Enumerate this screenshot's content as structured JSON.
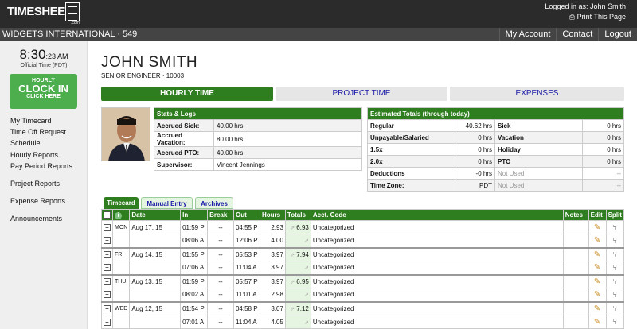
{
  "header": {
    "logo": "TIMESHEETS",
    "logo_suffix": ".com",
    "logged_in": "Logged in as: John Smith",
    "print": "Print This Page"
  },
  "subheader": {
    "company": "WIDGETS INTERNATIONAL · 549",
    "nav": [
      "My Account",
      "Contact",
      "Logout"
    ]
  },
  "clock": {
    "hm": "8:30",
    "sec": ":23 AM",
    "tz": "Official Time (PDT)",
    "btn_l1": "HOURLY",
    "btn_l2": "CLOCK IN",
    "btn_l3": "CLICK HERE"
  },
  "sidebar": {
    "items": [
      "My Timecard",
      "Time Off Request",
      "Schedule",
      "Hourly Reports",
      "Pay Period Reports",
      "Project Reports",
      "Expense Reports",
      "Announcements"
    ]
  },
  "employee": {
    "name": "JOHN SMITH",
    "title": "SENIOR ENGINEER · 10003"
  },
  "tabs": [
    "HOURLY TIME",
    "PROJECT TIME",
    "EXPENSES"
  ],
  "stats": {
    "header": "Stats & Logs",
    "rows": [
      {
        "k": "Accrued Sick:",
        "v": "40.00 hrs"
      },
      {
        "k": "Accrued Vacation:",
        "v": "80.00 hrs"
      },
      {
        "k": "Accrued PTO:",
        "v": "40.00 hrs"
      },
      {
        "k": "Supervisor:",
        "v": "Vincent Jennings"
      }
    ]
  },
  "totals": {
    "header": "Estimated Totals (through today)",
    "rows": [
      [
        "Regular",
        "40.62 hrs",
        "Sick",
        "0 hrs"
      ],
      [
        "Unpayable/Salaried",
        "0 hrs",
        "Vacation",
        "0 hrs"
      ],
      [
        "1.5x",
        "0 hrs",
        "Holiday",
        "0 hrs"
      ],
      [
        "2.0x",
        "0 hrs",
        "PTO",
        "0 hrs"
      ],
      [
        "Deductions",
        "-0 hrs",
        "Not Used",
        "--"
      ],
      [
        "Time Zone:",
        "PDT",
        "Not Used",
        "--"
      ]
    ]
  },
  "card_tabs": [
    "Timecard",
    "Manual Entry",
    "Archives"
  ],
  "timecard": {
    "columns": [
      "",
      "",
      "Date",
      "In",
      "Break",
      "Out",
      "Hours",
      "Totals",
      "Acct. Code",
      "Notes",
      "Edit",
      "Split"
    ],
    "rows": [
      {
        "day": "MON",
        "date": "Aug 17, 15",
        "in": "01:59 P",
        "brk": "--",
        "out": "04:55 P",
        "hours": "2.93",
        "total": "6.93",
        "acct": "Uncategorized"
      },
      {
        "day": "",
        "date": "",
        "in": "08:06 A",
        "brk": "--",
        "out": "12:06 P",
        "hours": "4.00",
        "total": "",
        "acct": "Uncategorized"
      },
      {
        "day": "FRI",
        "date": "Aug 14, 15",
        "in": "01:55 P",
        "brk": "--",
        "out": "05:53 P",
        "hours": "3.97",
        "total": "7.94",
        "acct": "Uncategorized"
      },
      {
        "day": "",
        "date": "",
        "in": "07:06 A",
        "brk": "--",
        "out": "11:04 A",
        "hours": "3.97",
        "total": "",
        "acct": "Uncategorized"
      },
      {
        "day": "THU",
        "date": "Aug 13, 15",
        "in": "01:59 P",
        "brk": "--",
        "out": "05:57 P",
        "hours": "3.97",
        "total": "6.95",
        "acct": "Uncategorized"
      },
      {
        "day": "",
        "date": "",
        "in": "08:02 A",
        "brk": "--",
        "out": "11:01 A",
        "hours": "2.98",
        "total": "",
        "acct": "Uncategorized"
      },
      {
        "day": "WED",
        "date": "Aug 12, 15",
        "in": "01:54 P",
        "brk": "--",
        "out": "04:58 P",
        "hours": "3.07",
        "total": "7.12",
        "acct": "Uncategorized"
      },
      {
        "day": "",
        "date": "",
        "in": "07:01 A",
        "brk": "--",
        "out": "11:04 A",
        "hours": "4.05",
        "total": "",
        "acct": "Uncategorized"
      }
    ]
  },
  "colors": {
    "accent_green": "#2e7d1e",
    "clock_green": "#4cae4c",
    "topbar": "#2b2b2b",
    "tab_link": "#1a1aa8"
  }
}
